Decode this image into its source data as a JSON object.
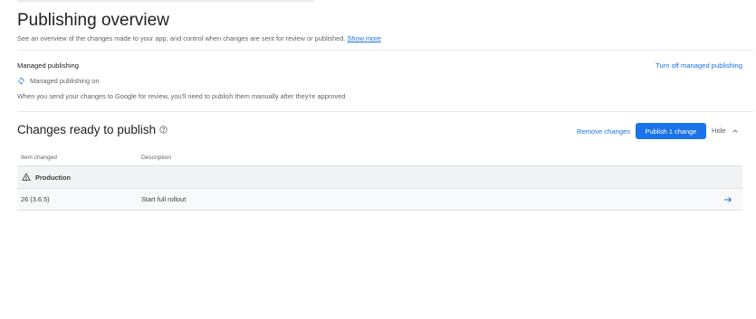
{
  "header": {
    "title": "Publishing overview",
    "subtitle": "See an overview of the changes made to your app, and control when changes are sent for review or published.",
    "show_more": "Show more"
  },
  "managed_publishing": {
    "title": "Managed publishing",
    "turn_off_link": "Turn off managed publishing",
    "status": "Managed publishing on",
    "note": "When you send your changes to Google for review, you'll need to publish them manually after they're approved"
  },
  "changes": {
    "title": "Changes ready to publish",
    "remove_label": "Remove changes",
    "publish_label": "Publish 1 change",
    "hide_label": "Hide",
    "columns": [
      "Item changed",
      "Description"
    ],
    "groups": [
      {
        "name": "Production",
        "rows": [
          {
            "item": "26 (3.6.5)",
            "description": "Start full rollout"
          }
        ]
      }
    ]
  },
  "colors": {
    "accent": "#1a73e8",
    "text": "#202124",
    "muted": "#5f6368",
    "divider": "#e8eaed"
  },
  "icons": [
    "sync-icon",
    "help-icon",
    "chevron-up-icon",
    "warning-icon",
    "arrow-right-icon"
  ]
}
